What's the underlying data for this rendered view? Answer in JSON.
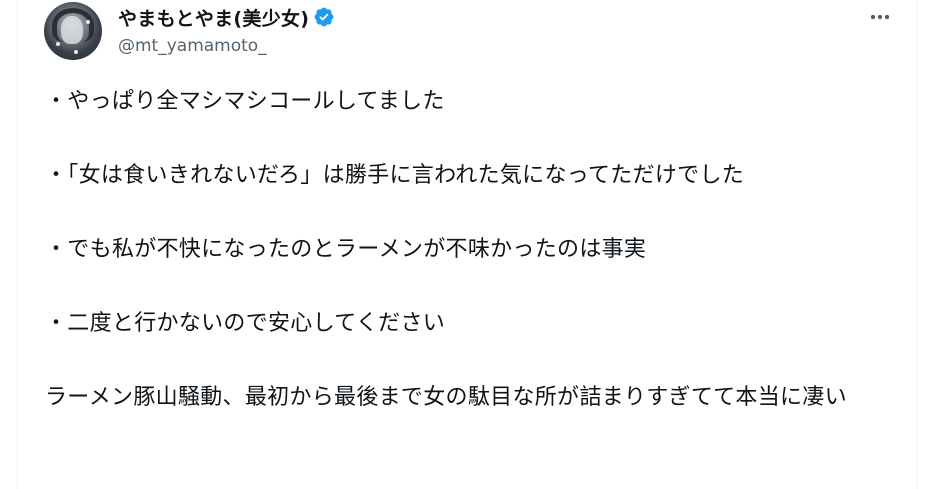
{
  "author": {
    "display_name": "やまもとやま(美少女)",
    "handle": "@mt_yamamoto_",
    "verified": true,
    "verified_color": "#1d9bf0"
  },
  "icons": {
    "avatar": "profile-avatar",
    "verified": "verified-badge-icon",
    "more": "more-horizontal-icon"
  },
  "tweet": {
    "line1": "・やっぱり全マシマシコールしてました",
    "line2": "・「女は食いきれないだろ」は勝手に言われた気になってただけでした",
    "line3": "・でも私が不快になったのとラーメンが不味かったのは事実",
    "line4": "・二度と行かないので安心してください",
    "line5": "ラーメン豚山騒動、最初から最後まで女の駄目な所が詰まりすぎてて本当に凄い"
  }
}
